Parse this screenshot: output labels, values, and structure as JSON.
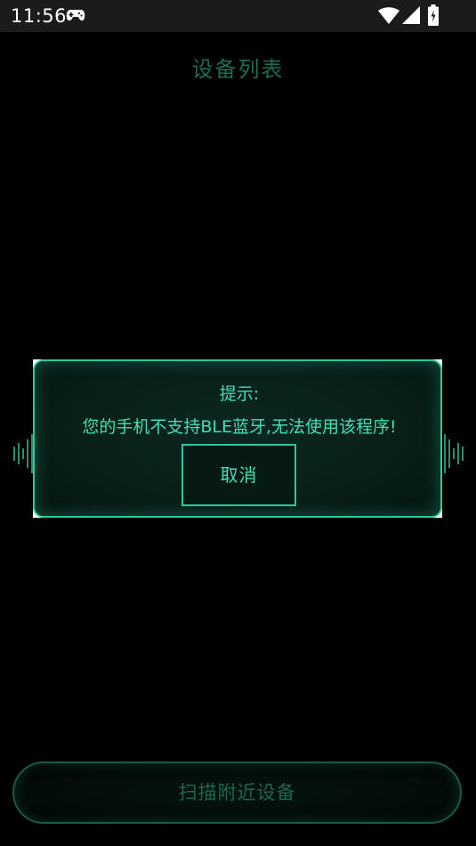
{
  "status_bar": {
    "time": "11:56"
  },
  "page": {
    "title": "设备列表"
  },
  "dialog": {
    "title": "提示:",
    "message": "您的手机不支持BLE蓝牙,无法使用该程序!",
    "cancel_label": "取消"
  },
  "bottom": {
    "scan_label": "扫描附近设备"
  },
  "colors": {
    "accent": "#42e0b0",
    "border": "#2fc79a",
    "dim_text": "#1e6b54",
    "background": "#000000"
  },
  "icons": [
    "gamepad-icon",
    "wifi-icon",
    "signal-icon",
    "battery-icon",
    "sound-wave-icon"
  ]
}
